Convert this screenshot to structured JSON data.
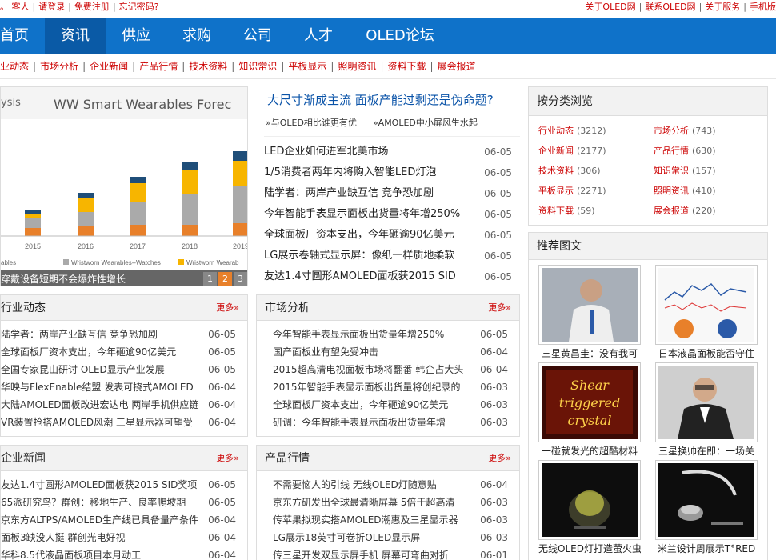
{
  "topbar": {
    "left": [
      "。",
      "客人",
      "请登录",
      "免费注册",
      "忘记密码?"
    ],
    "right": [
      "关于OLED网",
      "联系OLED网",
      "关于服务",
      "手机版"
    ]
  },
  "nav": [
    "首页",
    "资讯",
    "供应",
    "求购",
    "公司",
    "人才",
    "OLED论坛"
  ],
  "subnav": [
    "业动态",
    "市场分析",
    "企业新闻",
    "产品行情",
    "技术资料",
    "知识常识",
    "平板显示",
    "照明资讯",
    "资料下载",
    "展会报道"
  ],
  "slideshow": {
    "brand": "ysis",
    "chart_title": "WW Smart Wearables Forec",
    "years": [
      "2015",
      "2016",
      "2017",
      "2018",
      "2019"
    ],
    "legend": [
      "ables",
      "Wristworn Wearables--Watches",
      "Wristworn Wearab"
    ],
    "caption": "穿戴设备短期不会爆炸性增长",
    "pages": [
      "1",
      "2",
      "3"
    ],
    "active_page": "2",
    "colors": {
      "gray": "#aaaaaa",
      "gold": "#f7b500",
      "orange": "#e8802a",
      "navy": "#1f4e79"
    }
  },
  "headline": {
    "title": "大尺寸渐成主流 面板产能过剩还是伪命题?",
    "links": [
      "»与OLED相比谁更有优",
      "»AMOLED中小屏风生水起"
    ]
  },
  "top_news": [
    {
      "title": "LED企业如何进军北美市场",
      "date": "06-05"
    },
    {
      "title": "1/5消费者两年内将购入智能LED灯泡",
      "date": "06-05"
    },
    {
      "title": "陆学者：两岸产业缺互信 竞争恐加剧",
      "date": "06-05"
    },
    {
      "title": "今年智能手表显示面板出货量将年增250%",
      "date": "06-05"
    },
    {
      "title": "全球面板厂资本支出，今年砸逾90亿美元",
      "date": "06-05"
    },
    {
      "title": "LG展示卷轴式显示屏：像纸一样质地柔软",
      "date": "06-05"
    },
    {
      "title": "友达1.4寸圆形AMOLED面板获2015 SID",
      "date": "06-05"
    }
  ],
  "more_label": "更多»",
  "boxes": {
    "industry": {
      "title": "行业动态",
      "items": [
        {
          "title": "陆学者：两岸产业缺互信 竞争恐加剧",
          "date": "06-05"
        },
        {
          "title": "全球面板厂资本支出，今年砸逾90亿美元",
          "date": "06-05"
        },
        {
          "title": "全国专家昆山研讨 OLED显示产业发展",
          "date": "06-05"
        },
        {
          "title": "华映与FlexEnable结盟 发表可挠式AMOLED",
          "date": "06-04"
        },
        {
          "title": "大陆AMOLED面板改进宏达电 两岸手机供应链",
          "date": "06-04"
        },
        {
          "title": "VR装置抢搭AMOLED风潮 三星显示器可望受",
          "date": "06-04"
        }
      ]
    },
    "market": {
      "title": "市场分析",
      "items": [
        {
          "title": "今年智能手表显示面板出货量年增250%",
          "date": "06-05"
        },
        {
          "title": "国产面板业有望免受冲击",
          "date": "06-04"
        },
        {
          "title": "2015超高清电视面板市场将翻番 韩企占大头",
          "date": "06-04"
        },
        {
          "title": "2015年智能手表显示面板出货量将创纪录的",
          "date": "06-03"
        },
        {
          "title": "全球面板厂资本支出，今年砸逾90亿美元",
          "date": "06-03"
        },
        {
          "title": "研调：今年智能手表显示面板出货量年增",
          "date": "06-03"
        }
      ]
    },
    "company": {
      "title": "企业新闻",
      "items": [
        {
          "title": "友达1.4寸圆形AMOLED面板获2015 SID奖项",
          "date": "06-05"
        },
        {
          "title": "65派研究鸟？群创：移地生产、良率爬坡期",
          "date": "06-05"
        },
        {
          "title": "京东方ALTPS/AMOLED生产线已具备量产条件",
          "date": "06-04"
        },
        {
          "title": "面板3缺没人挺 群创光电好视",
          "date": "06-04"
        },
        {
          "title": "华科8.5代液晶面板项目本月动工",
          "date": "06-04"
        }
      ]
    },
    "product": {
      "title": "产品行情",
      "items": [
        {
          "title": "不需要恼人的引线 无线OLED灯随意贴",
          "date": "06-04"
        },
        {
          "title": "京东方研发出全球最清晰屏幕 5倍于超高清",
          "date": "06-03"
        },
        {
          "title": "传苹果拟现实搭AMOLED潮惠及三星显示器",
          "date": "06-03"
        },
        {
          "title": "LG展示18英寸可卷折OLED显示屏",
          "date": "06-03"
        },
        {
          "title": "传三星开发双显示屏手机 屏幕可弯曲对折",
          "date": "06-01"
        }
      ]
    }
  },
  "category": {
    "title": "按分类浏览",
    "items": [
      {
        "name": "行业动态",
        "count": "(3212)"
      },
      {
        "name": "市场分析",
        "count": "(743)"
      },
      {
        "name": "企业新闻",
        "count": "(2177)"
      },
      {
        "name": "产品行情",
        "count": "(630)"
      },
      {
        "name": "技术资料",
        "count": "(306)"
      },
      {
        "name": "知识常识",
        "count": "(157)"
      },
      {
        "name": "平板显示",
        "count": "(2271)"
      },
      {
        "name": "照明资讯",
        "count": "(410)"
      },
      {
        "name": "资料下载",
        "count": "(59)"
      },
      {
        "name": "展会报道",
        "count": "(220)"
      }
    ]
  },
  "recommended": {
    "title": "推荐图文",
    "items": [
      {
        "caption": "三星黄昌圭：没有我可"
      },
      {
        "caption": "日本液晶面板能否守住"
      },
      {
        "caption": "一碰就发光的超酷材料",
        "image_text": [
          "Shear",
          "triggered",
          "crystal"
        ]
      },
      {
        "caption": "三星换帅在即：一场关"
      },
      {
        "caption": "无线OLED灯打造萤火虫"
      },
      {
        "caption": "米兰设计周展示T°RED"
      }
    ]
  }
}
